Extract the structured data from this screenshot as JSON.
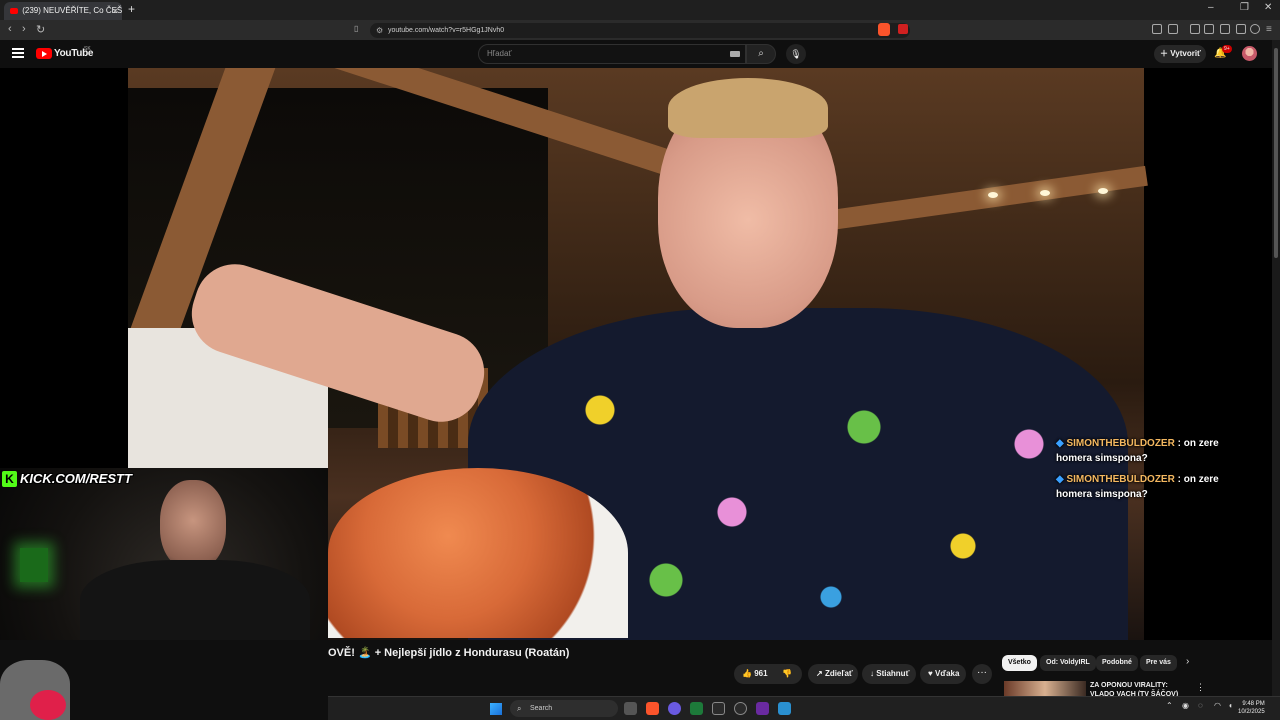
{
  "browser": {
    "tab_title": "(239) NEUVĚŘÍTE, Co ČEŠI Pr...",
    "tab_close": "×",
    "new_tab": "+",
    "url": "youtube.com/watch?v=r5HGg1JNvh0",
    "back": "‹",
    "forward": "›",
    "reload": "↻",
    "window_controls": [
      "–",
      "❐",
      "✕"
    ]
  },
  "youtube": {
    "logo_text": "YouTube",
    "country_code": "SK",
    "search_placeholder": "Hľadať",
    "search_icon": "search-icon",
    "create_label": "Vytvoriť",
    "notif_badge": "9+"
  },
  "video": {
    "title": "OVĚ! 🏝️ + Nejlepší jídlo z Hondurasu (Roatán)",
    "likes": "961",
    "share_label": "Zdieľať",
    "download_label": "Stiahnuť",
    "thanks_label": "Vďaka",
    "more": "···"
  },
  "chat_overlay": [
    {
      "user": "SIMONTHEBULDOZER",
      "message": ": on zere homera simspona?"
    },
    {
      "user": "SIMONTHEBULDOZER",
      "message": ": on zere homera simspona?"
    }
  ],
  "webcam": {
    "kick_letter": "K",
    "kick_url": "KICK.COM/RESTT"
  },
  "chips": [
    "Všetko",
    "Od: VoldyIRL",
    "Podobné",
    "Pre vás"
  ],
  "recommended": [
    {
      "title": "ZA OPONOU VIRALITY: VLADO VACH (TV ŠÁČOV)"
    }
  ],
  "taskbar": {
    "search_label": "Search",
    "time": "9:48 PM",
    "date": "10/2/2025"
  },
  "colors": {
    "youtube_red": "#ff0000",
    "kick_green": "#53fc18",
    "chat_user": "#f4b860",
    "background": "#0f0f0f"
  }
}
